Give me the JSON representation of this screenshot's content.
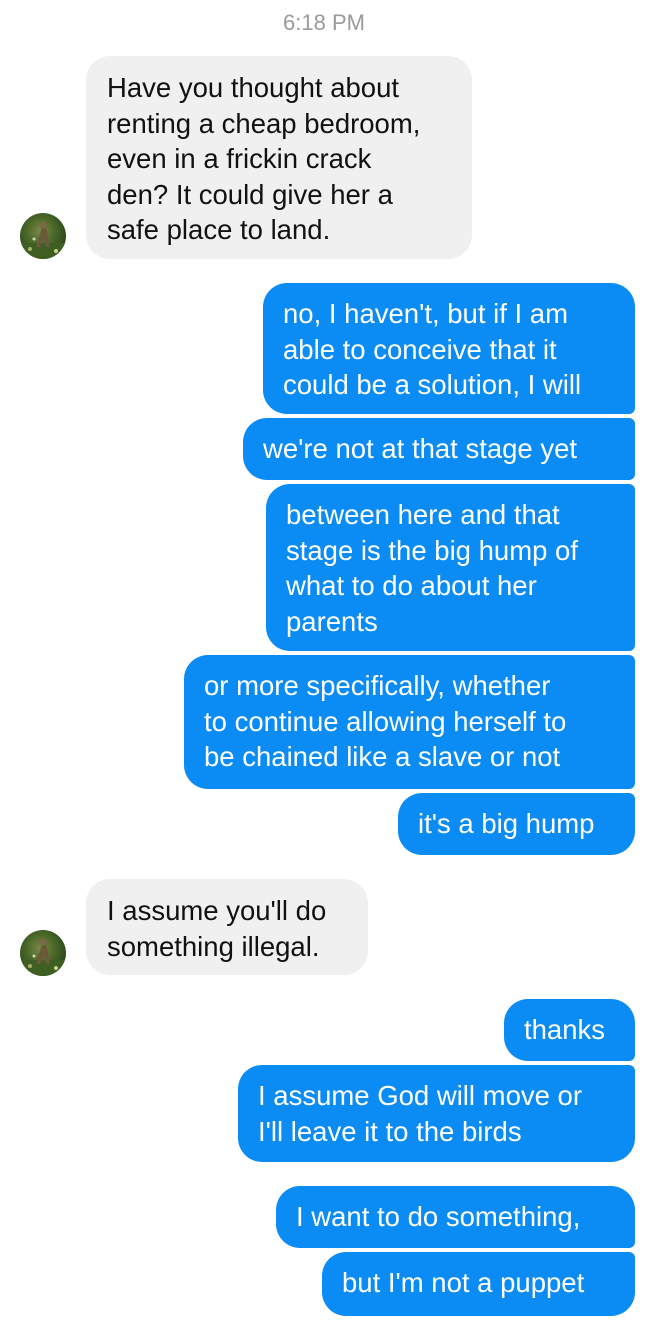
{
  "conversation": {
    "timestamp": "6:18 PM",
    "messages": [
      {
        "from": "them",
        "text": "Have you thought about\nrenting a cheap bedroom,\neven in a frickin crack\nden? It could give her a\nsafe place to land."
      },
      {
        "from": "me",
        "text": "no, I haven't, but if I am\nable to conceive that it\ncould be a solution, I will"
      },
      {
        "from": "me",
        "text": "we're not at that stage yet"
      },
      {
        "from": "me",
        "text": "between here and that\nstage is the big hump of\nwhat to do about her\nparents"
      },
      {
        "from": "me",
        "text": "or more specifically, whether\nto continue allowing herself to\nbe chained like a slave or not"
      },
      {
        "from": "me",
        "text": "it's a big hump"
      },
      {
        "from": "them",
        "text": "I assume you'll do\nsomething illegal."
      },
      {
        "from": "me",
        "text": "thanks"
      },
      {
        "from": "me",
        "text": "I assume God will move or\nI'll leave it to the birds"
      },
      {
        "from": "me",
        "text": "I want to do something,"
      },
      {
        "from": "me",
        "text": "but I'm not a puppet"
      }
    ]
  },
  "colors": {
    "outgoing_bubble": "#0b8cf5",
    "incoming_bubble": "#f1f0f0",
    "timestamp": "#9a9a9a"
  },
  "icons": {
    "avatar": "contact-avatar-icon"
  }
}
